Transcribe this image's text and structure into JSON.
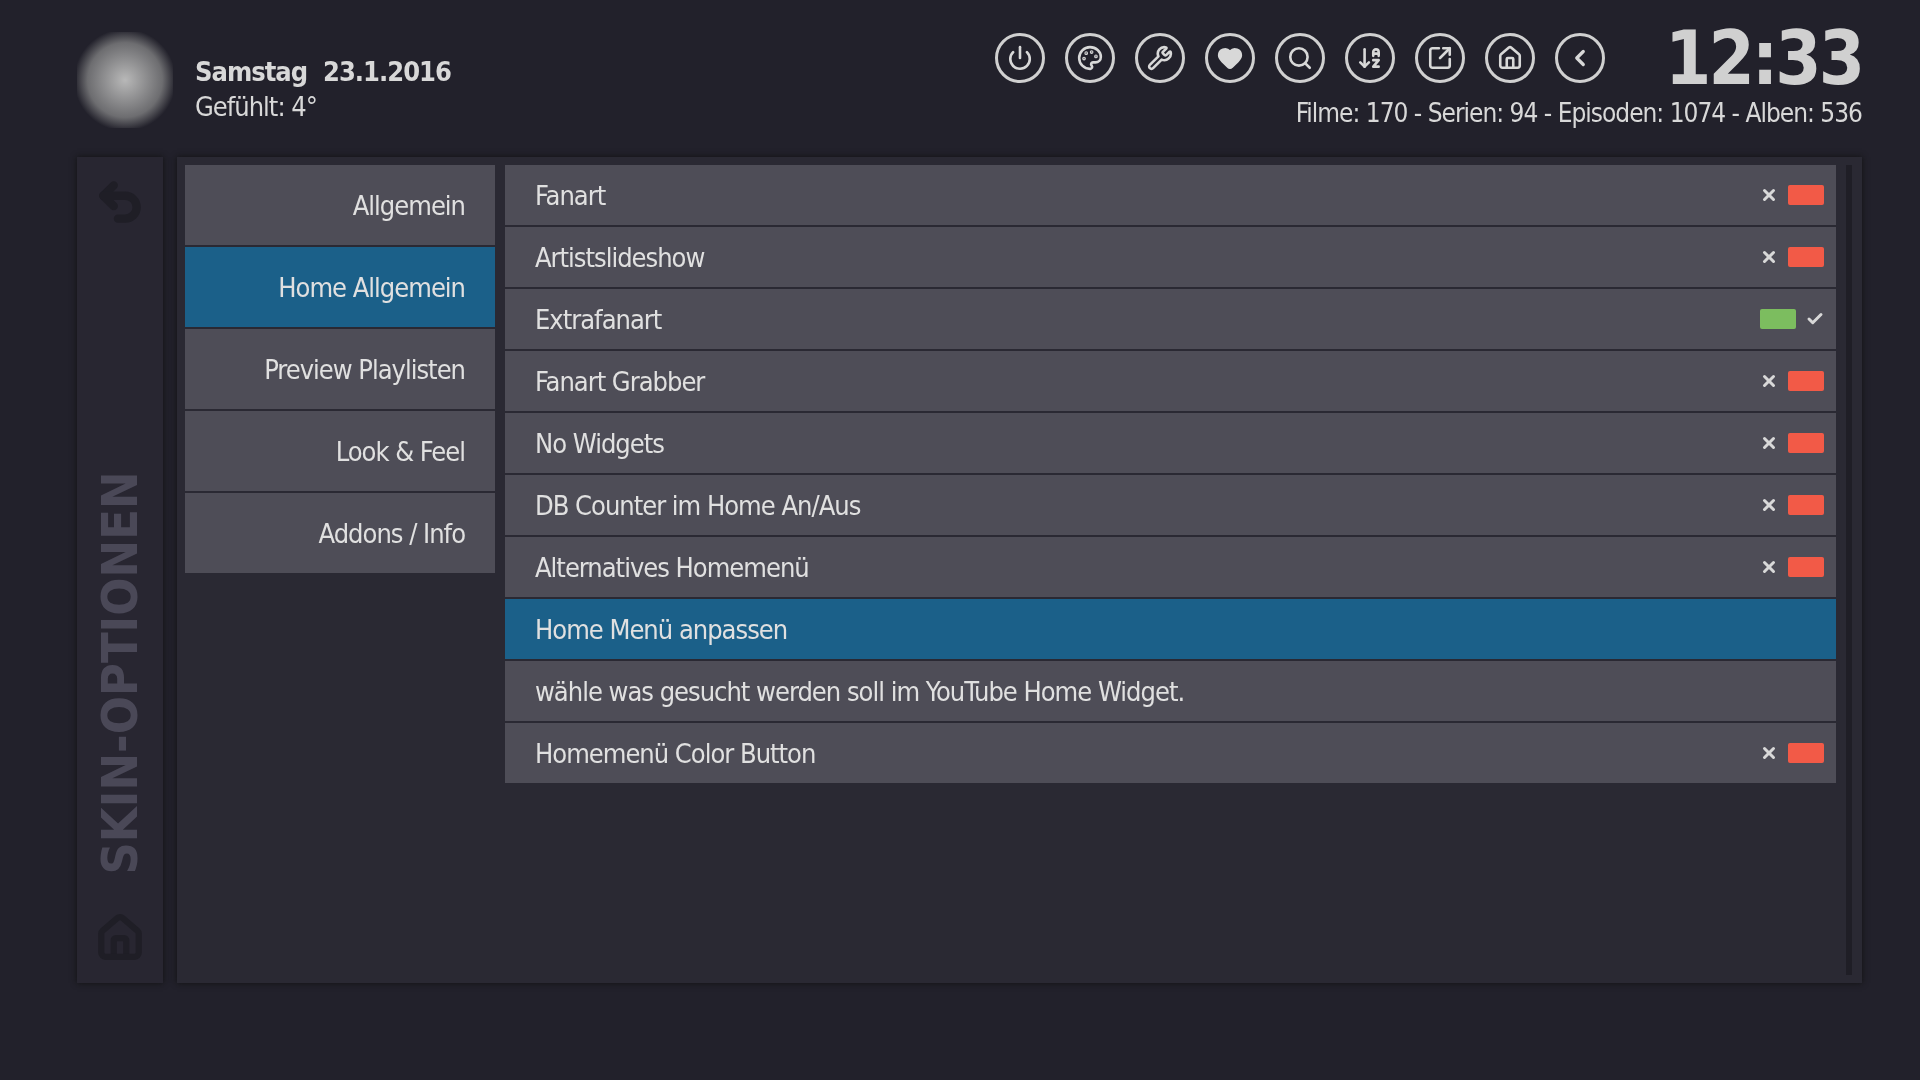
{
  "header": {
    "day": "Samstag",
    "date": "23.1.2016",
    "feels_like": "Gefühlt: 4°",
    "time": "12:33",
    "counts": "Filme: 170 - Serien: 94 - Episoden: 1074 - Alben: 536"
  },
  "toolbar": [
    {
      "kind": "power"
    },
    {
      "kind": "palette"
    },
    {
      "kind": "tools"
    },
    {
      "kind": "heart"
    },
    {
      "kind": "search"
    },
    {
      "kind": "sort"
    },
    {
      "kind": "export"
    },
    {
      "kind": "home"
    },
    {
      "kind": "back"
    }
  ],
  "side_title": "SKIN-OPTIONEN",
  "categories": [
    {
      "label": "Allgemein",
      "selected": false
    },
    {
      "label": "Home Allgemein",
      "selected": true
    },
    {
      "label": "Preview Playlisten",
      "selected": false
    },
    {
      "label": "Look & Feel",
      "selected": false
    },
    {
      "label": "Addons / Info",
      "selected": false
    }
  ],
  "settings": [
    {
      "kind": "toggle",
      "label": "Fanart",
      "on": false,
      "selected": false
    },
    {
      "kind": "toggle",
      "label": "Artistslideshow",
      "on": false,
      "selected": false
    },
    {
      "kind": "toggle",
      "label": "Extrafanart",
      "on": true,
      "selected": false
    },
    {
      "kind": "toggle",
      "label": "Fanart Grabber",
      "on": false,
      "selected": false
    },
    {
      "kind": "toggle",
      "label": "No Widgets",
      "on": false,
      "selected": false
    },
    {
      "kind": "toggle",
      "label": "DB Counter im Home An/Aus",
      "on": false,
      "selected": false
    },
    {
      "kind": "toggle",
      "label": "Alternatives Homemenü",
      "on": false,
      "selected": false
    },
    {
      "kind": "action",
      "label": "Home Menü anpassen",
      "selected": true
    },
    {
      "kind": "action",
      "label": "wähle was gesucht werden soll im YouTube Home Widget.",
      "selected": false
    },
    {
      "kind": "toggle",
      "label": "Homemenü Color Button",
      "on": false,
      "selected": false
    }
  ]
}
